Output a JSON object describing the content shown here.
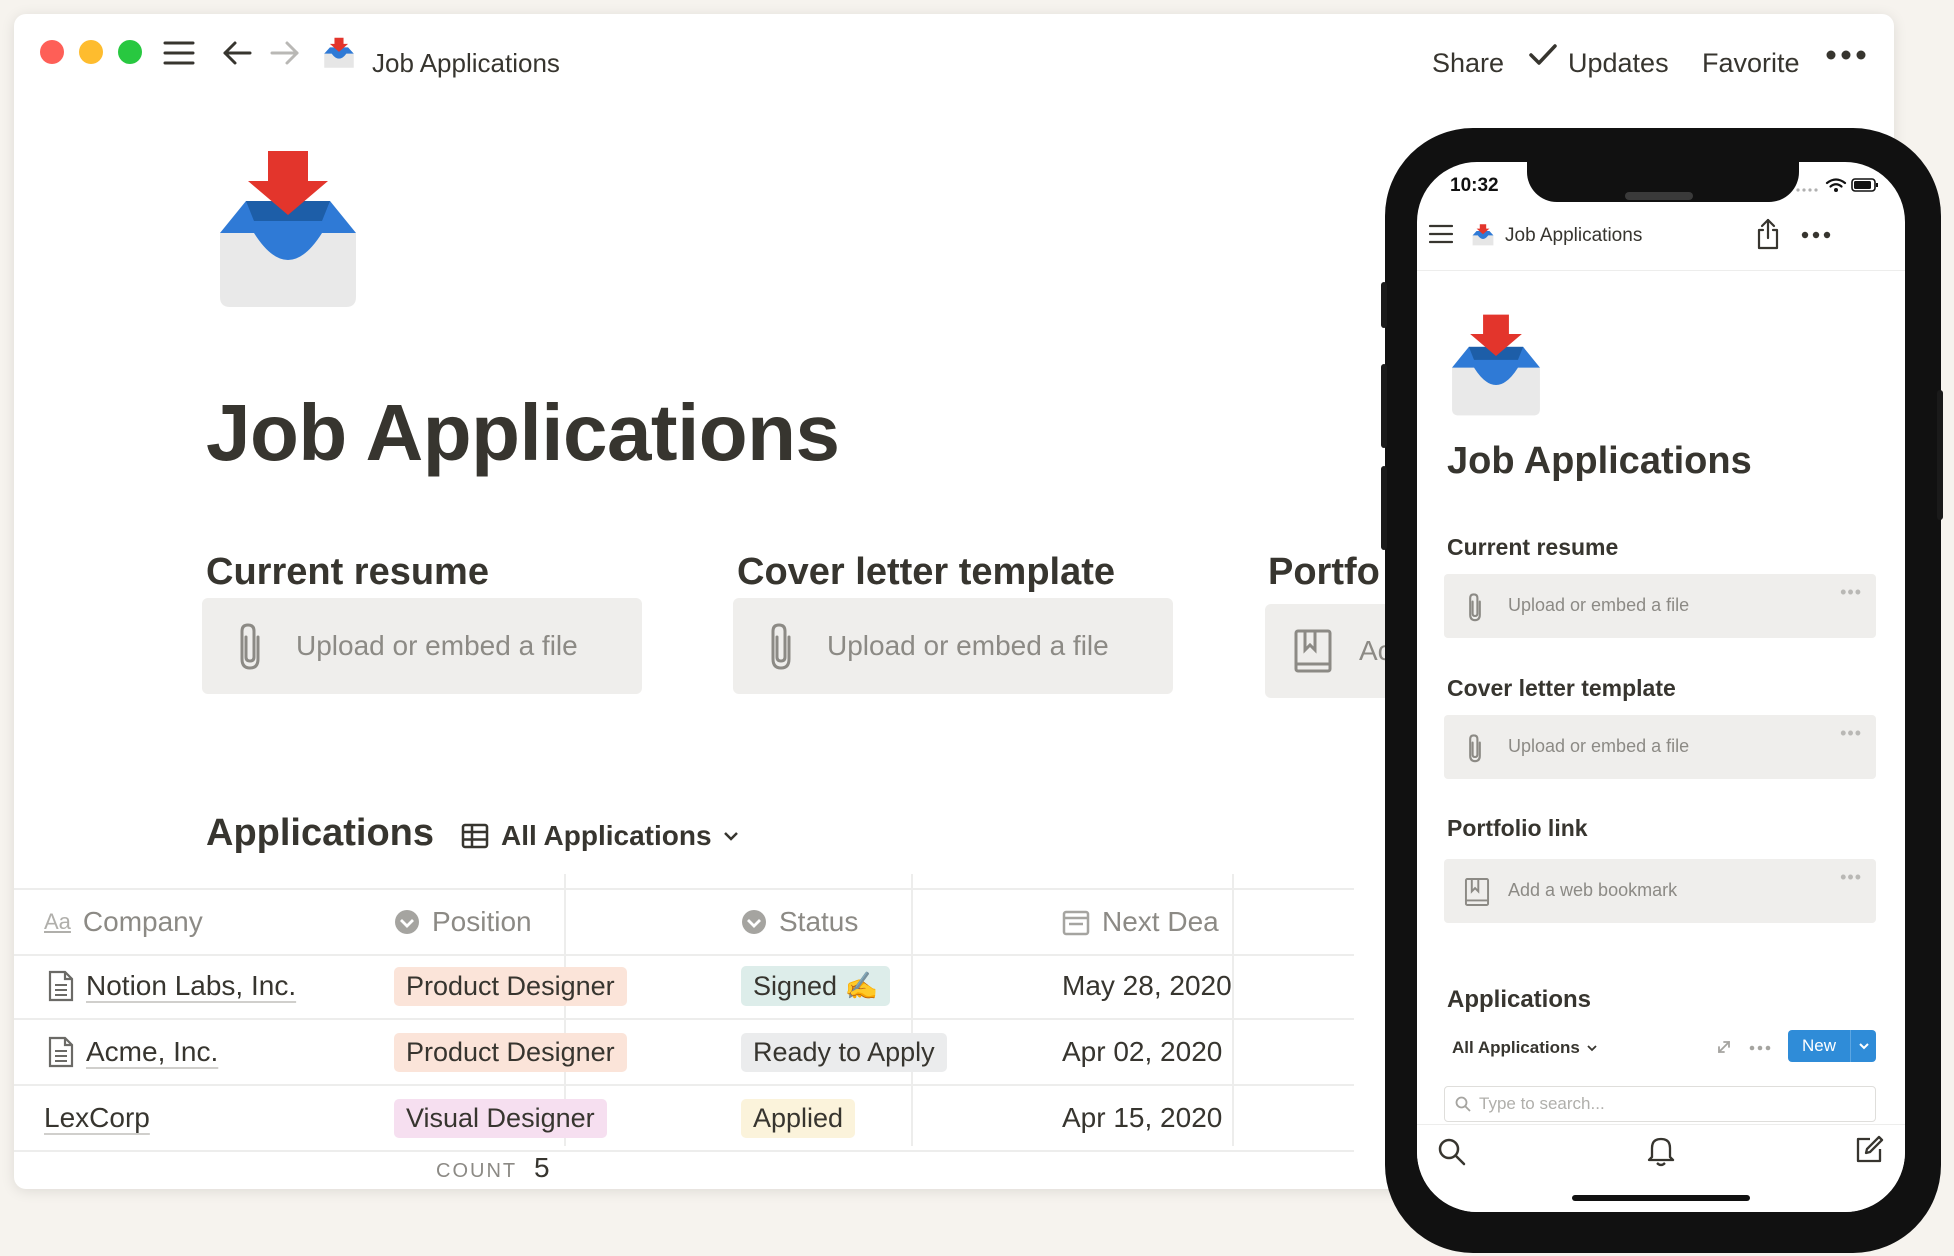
{
  "titlebar": {
    "title": "Job Applications",
    "share": "Share",
    "updates": "Updates",
    "favorite": "Favorite"
  },
  "page": {
    "title": "Job Applications",
    "properties": [
      {
        "title": "Current resume",
        "placeholder": "Upload or embed a file"
      },
      {
        "title": "Cover letter template",
        "placeholder": "Upload or embed a file"
      },
      {
        "title": "Portfo",
        "placeholder": "Ac"
      }
    ],
    "database": {
      "title": "Applications",
      "view": "All Applications",
      "columns": [
        "Company",
        "Position",
        "Status",
        "Next Dea"
      ],
      "rows": [
        {
          "company": "Notion Labs, Inc.",
          "position": "Product Designer",
          "status": "Signed ✍️",
          "date": "May 28, 2020"
        },
        {
          "company": "Acme, Inc.",
          "position": "Product Designer",
          "status": "Ready to Apply",
          "date": "Apr 02, 2020"
        },
        {
          "company": "LexCorp",
          "position": "Visual Designer",
          "status": "Applied",
          "date": "Apr 15, 2020"
        }
      ],
      "count_label": "COUNT",
      "count_value": "5"
    }
  },
  "colors": {
    "tag_product_designer": "#fbe4d9",
    "tag_visual_designer": "#f6dff0",
    "tag_signed": "#ddedea",
    "tag_ready": "#ebeced",
    "tag_applied": "#fbf3db"
  },
  "phone": {
    "time": "10:32",
    "header_title": "Job Applications",
    "page_title": "Job Applications",
    "properties": [
      {
        "title": "Current resume",
        "placeholder": "Upload or embed a file"
      },
      {
        "title": "Cover letter template",
        "placeholder": "Upload or embed a file"
      },
      {
        "title": "Portfolio link",
        "placeholder": "Add a web bookmark"
      }
    ],
    "db_title": "Applications",
    "view": "All Applications",
    "new_button": "New",
    "search_placeholder": "Type to search..."
  }
}
